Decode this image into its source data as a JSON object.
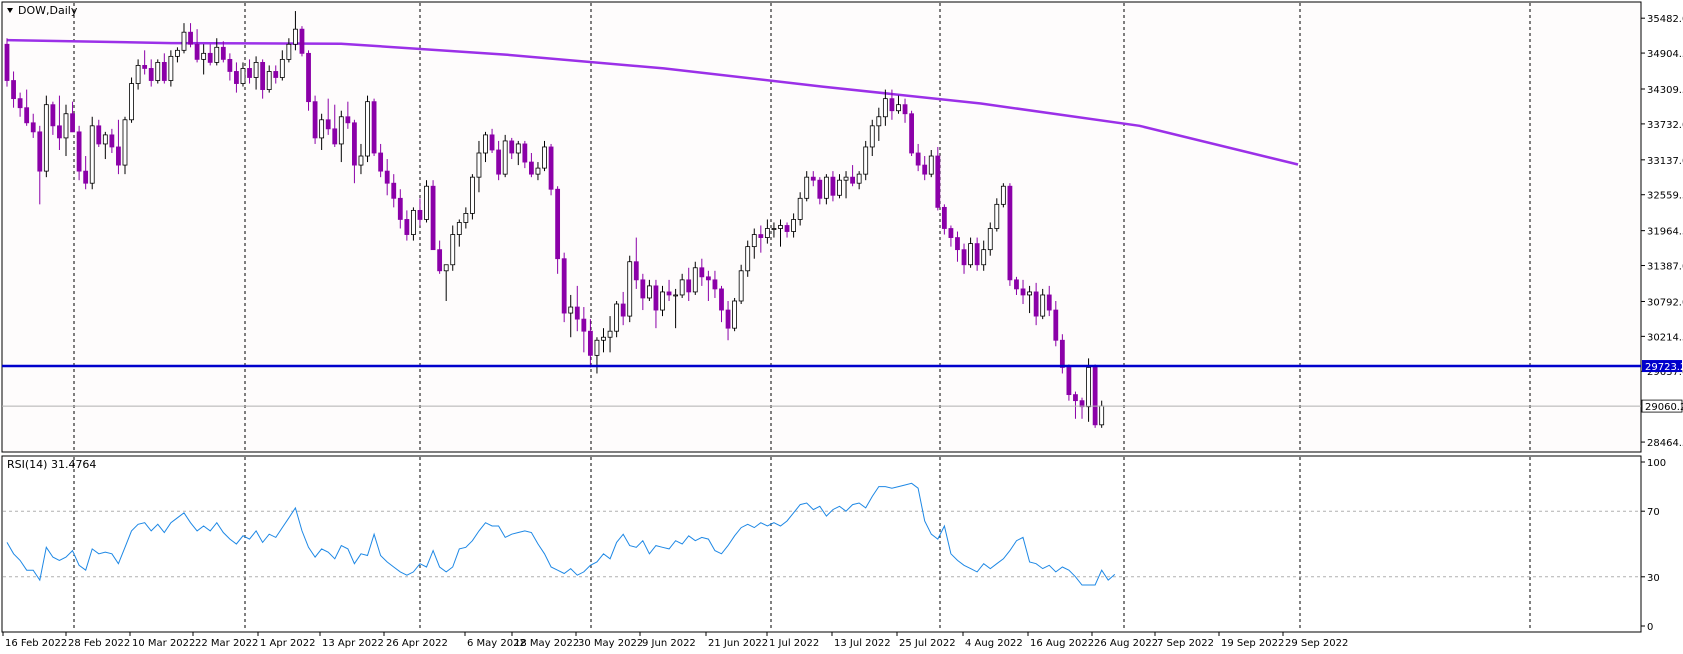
{
  "chart_window": {
    "symbol_timeframe": "DOW,Daily",
    "indicator_label": "RSI(14) 31.4764",
    "colors": {
      "background": "#fefcfc",
      "panel_background": "#ffffff",
      "bull_candle_fill": "#ffffff",
      "bull_candle_border": "#000000",
      "bear_candle_fill": "#8b00a8",
      "moving_average": "#9b30e8",
      "support_line": "#0000cc",
      "rsi_line": "#1e88e5",
      "grid_line": "#000000",
      "level_line": "#b0b0b0"
    }
  },
  "chart_data": [
    {
      "type": "candlestick",
      "panel": "price",
      "x_tick_labels": [
        "16 Feb 2022",
        "28 Feb 2022",
        "10 Mar 2022",
        "22 Mar 2022",
        "1 Apr 2022",
        "13 Apr 2022",
        "26 Apr 2022",
        "6 May 2022",
        "18 May 2022",
        "30 May 2022",
        "9 Jun 2022",
        "21 Jun 2022",
        "1 Jul 2022",
        "13 Jul 2022",
        "25 Jul 2022",
        "4 Aug 2022",
        "16 Aug 2022",
        "26 Aug 2022",
        "7 Sep 2022",
        "19 Sep 2022",
        "29 Sep 2022"
      ],
      "y_tick_labels": [
        "35482.0",
        "34904.5",
        "34309.5",
        "33732.0",
        "33137.0",
        "32559.5",
        "31964.5",
        "31387.0",
        "30792.0",
        "30214.5",
        "29637.0",
        "28464.5"
      ],
      "ylim": [
        28300,
        35750
      ],
      "horizontal_levels": [
        {
          "label": "29723.2",
          "value": 29723.2
        },
        {
          "label": "29060.2",
          "value": 29060.2
        }
      ],
      "moving_average_points": [
        {
          "date": "2022-02-14",
          "value": 35120
        },
        {
          "date": "2022-03-15",
          "value": 35070
        },
        {
          "date": "2022-04-14",
          "value": 35060
        },
        {
          "date": "2022-05-13",
          "value": 34880
        },
        {
          "date": "2022-06-10",
          "value": 34650
        },
        {
          "date": "2022-07-08",
          "value": 34350
        },
        {
          "date": "2022-08-05",
          "value": 34070
        },
        {
          "date": "2022-09-02",
          "value": 33700
        },
        {
          "date": "2022-09-30",
          "value": 33060
        }
      ],
      "candles_ohlc": [
        [
          35050,
          35150,
          34350,
          34450
        ],
        [
          34450,
          34600,
          34000,
          34150
        ],
        [
          34150,
          34250,
          33850,
          34000
        ],
        [
          34000,
          34300,
          33700,
          33750
        ],
        [
          33750,
          33900,
          33500,
          33600
        ],
        [
          33600,
          33700,
          32400,
          32950
        ],
        [
          32950,
          34200,
          32850,
          34050
        ],
        [
          34050,
          34100,
          33550,
          33700
        ],
        [
          33700,
          34200,
          33300,
          33500
        ],
        [
          33500,
          34050,
          33200,
          33900
        ],
        [
          33900,
          34100,
          33600,
          33600
        ],
        [
          33600,
          33700,
          32800,
          32950
        ],
        [
          32950,
          33200,
          32650,
          32750
        ],
        [
          32750,
          33850,
          32650,
          33700
        ],
        [
          33700,
          33800,
          33350,
          33400
        ],
        [
          33400,
          33600,
          33150,
          33550
        ],
        [
          33550,
          33650,
          33250,
          33350
        ],
        [
          33350,
          33800,
          32900,
          33050
        ],
        [
          33050,
          33850,
          32900,
          33800
        ],
        [
          33800,
          34500,
          33750,
          34400
        ],
        [
          34400,
          34800,
          34300,
          34700
        ],
        [
          34700,
          34950,
          34550,
          34650
        ],
        [
          34650,
          34800,
          34350,
          34450
        ],
        [
          34450,
          34800,
          34400,
          34750
        ],
        [
          34750,
          34900,
          34400,
          34450
        ],
        [
          34450,
          34950,
          34350,
          34850
        ],
        [
          34850,
          35000,
          34750,
          34950
        ],
        [
          34950,
          35400,
          34900,
          35250
        ],
        [
          35250,
          35400,
          35000,
          35050
        ],
        [
          35050,
          35300,
          34750,
          34800
        ],
        [
          34800,
          35050,
          34550,
          34900
        ],
        [
          34900,
          35050,
          34700,
          34750
        ],
        [
          34750,
          35150,
          34700,
          35000
        ],
        [
          35000,
          35100,
          34750,
          34800
        ],
        [
          34800,
          34900,
          34450,
          34600
        ],
        [
          34600,
          34750,
          34250,
          34400
        ],
        [
          34400,
          34750,
          34350,
          34650
        ],
        [
          34650,
          34800,
          34400,
          34500
        ],
        [
          34500,
          34850,
          34300,
          34750
        ],
        [
          34750,
          34800,
          34150,
          34300
        ],
        [
          34300,
          34700,
          34250,
          34600
        ],
        [
          34600,
          34700,
          34400,
          34500
        ],
        [
          34500,
          34950,
          34450,
          34800
        ],
        [
          34800,
          35150,
          34750,
          35050
        ],
        [
          35050,
          35600,
          34950,
          35300
        ],
        [
          35300,
          35350,
          34850,
          34900
        ],
        [
          34900,
          34950,
          33950,
          34100
        ],
        [
          34100,
          34200,
          33400,
          33500
        ],
        [
          33500,
          33900,
          33300,
          33800
        ],
        [
          33800,
          34150,
          33550,
          33650
        ],
        [
          33650,
          34050,
          33350,
          33400
        ],
        [
          33400,
          33950,
          33100,
          33850
        ],
        [
          33850,
          34100,
          33650,
          33750
        ],
        [
          33750,
          33800,
          32750,
          33050
        ],
        [
          33050,
          33400,
          32900,
          33200
        ],
        [
          33200,
          34200,
          33100,
          34100
        ],
        [
          34100,
          34150,
          33200,
          33250
        ],
        [
          33250,
          33400,
          32850,
          32950
        ],
        [
          32950,
          33150,
          32550,
          32750
        ],
        [
          32750,
          32900,
          32350,
          32500
        ],
        [
          32500,
          32650,
          32000,
          32150
        ],
        [
          32150,
          32300,
          31800,
          31900
        ],
        [
          31900,
          32350,
          31800,
          32300
        ],
        [
          32300,
          32500,
          32050,
          32150
        ],
        [
          32150,
          32800,
          32100,
          32700
        ],
        [
          32700,
          32800,
          31650,
          31650
        ],
        [
          31650,
          31800,
          31250,
          31300
        ],
        [
          31300,
          31400,
          30800,
          31400
        ],
        [
          31400,
          32050,
          31300,
          31900
        ],
        [
          31900,
          32150,
          31700,
          32100
        ],
        [
          32100,
          32350,
          32000,
          32250
        ],
        [
          32250,
          32900,
          32150,
          32850
        ],
        [
          32850,
          33450,
          32600,
          33250
        ],
        [
          33250,
          33600,
          33100,
          33550
        ],
        [
          33550,
          33650,
          33250,
          33300
        ],
        [
          33300,
          33450,
          32800,
          32900
        ],
        [
          32900,
          33550,
          32850,
          33450
        ],
        [
          33450,
          33500,
          33150,
          33250
        ],
        [
          33250,
          33450,
          33050,
          33400
        ],
        [
          33400,
          33450,
          33000,
          33100
        ],
        [
          33100,
          33250,
          32850,
          32900
        ],
        [
          32900,
          33100,
          32800,
          33000
        ],
        [
          33000,
          33450,
          32950,
          33350
        ],
        [
          33350,
          33400,
          32550,
          32650
        ],
        [
          32650,
          32700,
          31250,
          31500
        ],
        [
          31500,
          31600,
          30450,
          30600
        ],
        [
          30600,
          30900,
          30200,
          30700
        ],
        [
          30700,
          31050,
          30300,
          30500
        ],
        [
          30500,
          30700,
          29950,
          30300
        ],
        [
          30300,
          30500,
          29700,
          29900
        ],
        [
          29900,
          30200,
          29600,
          30150
        ],
        [
          30150,
          30350,
          29950,
          30200
        ],
        [
          30200,
          30550,
          29950,
          30300
        ],
        [
          30300,
          30800,
          30200,
          30750
        ],
        [
          30750,
          30950,
          30400,
          30550
        ],
        [
          30550,
          31550,
          30450,
          31450
        ],
        [
          31450,
          31850,
          31000,
          31150
        ],
        [
          31150,
          31250,
          30650,
          30850
        ],
        [
          30850,
          31150,
          30800,
          31050
        ],
        [
          31050,
          31150,
          30350,
          30650
        ],
        [
          30650,
          31050,
          30550,
          30950
        ],
        [
          30950,
          31150,
          30800,
          30900
        ],
        [
          30900,
          31000,
          30350,
          30900
        ],
        [
          30900,
          31250,
          30850,
          31150
        ],
        [
          31150,
          31350,
          30800,
          30950
        ],
        [
          30950,
          31450,
          30900,
          31350
        ],
        [
          31350,
          31500,
          31050,
          31200
        ],
        [
          31200,
          31300,
          30800,
          31150
        ],
        [
          31150,
          31300,
          30850,
          31000
        ],
        [
          31000,
          31050,
          30450,
          30650
        ],
        [
          30650,
          30800,
          30150,
          30350
        ],
        [
          30350,
          30850,
          30300,
          30800
        ],
        [
          30800,
          31400,
          30750,
          31300
        ],
        [
          31300,
          31800,
          31200,
          31700
        ],
        [
          31700,
          32000,
          31500,
          31900
        ],
        [
          31900,
          32050,
          31600,
          31850
        ],
        [
          31850,
          32150,
          31750,
          32000
        ],
        [
          32000,
          32100,
          31850,
          32000
        ],
        [
          32000,
          32150,
          31700,
          32050
        ],
        [
          32050,
          32100,
          31850,
          31950
        ],
        [
          31950,
          32250,
          31850,
          32150
        ],
        [
          32150,
          32600,
          32050,
          32500
        ],
        [
          32500,
          32950,
          32450,
          32850
        ],
        [
          32850,
          32950,
          32700,
          32800
        ],
        [
          32800,
          32850,
          32400,
          32500
        ],
        [
          32500,
          32900,
          32400,
          32850
        ],
        [
          32850,
          32950,
          32450,
          32550
        ],
        [
          32550,
          32900,
          32500,
          32800
        ],
        [
          32800,
          32950,
          32500,
          32850
        ],
        [
          32850,
          33050,
          32700,
          32750
        ],
        [
          32750,
          32950,
          32650,
          32900
        ],
        [
          32900,
          33450,
          32800,
          33350
        ],
        [
          33350,
          33800,
          33200,
          33700
        ],
        [
          33700,
          34000,
          33450,
          33850
        ],
        [
          33850,
          34300,
          33700,
          34150
        ],
        [
          34150,
          34300,
          33800,
          33950
        ],
        [
          33950,
          34200,
          33900,
          34050
        ],
        [
          34050,
          34150,
          33750,
          33900
        ],
        [
          33900,
          33950,
          33200,
          33250
        ],
        [
          33250,
          33400,
          32950,
          33050
        ],
        [
          33050,
          33200,
          32800,
          32900
        ],
        [
          32900,
          33300,
          32850,
          33200
        ],
        [
          33200,
          33350,
          32300,
          32350
        ],
        [
          32350,
          32400,
          31900,
          32000
        ],
        [
          32000,
          32050,
          31700,
          31850
        ],
        [
          31850,
          31950,
          31450,
          31650
        ],
        [
          31650,
          31750,
          31250,
          31400
        ],
        [
          31400,
          31850,
          31350,
          31750
        ],
        [
          31750,
          31850,
          31300,
          31400
        ],
        [
          31400,
          31800,
          31300,
          31650
        ],
        [
          31650,
          32100,
          31550,
          32000
        ],
        [
          32000,
          32500,
          31950,
          32400
        ],
        [
          32400,
          32750,
          32350,
          32700
        ],
        [
          32700,
          32750,
          31050,
          31150
        ],
        [
          31150,
          31200,
          30900,
          31000
        ],
        [
          31000,
          31150,
          30750,
          30900
        ],
        [
          30900,
          31050,
          30600,
          30950
        ],
        [
          30950,
          31100,
          30400,
          30550
        ],
        [
          30550,
          31000,
          30500,
          30900
        ],
        [
          30900,
          31050,
          30550,
          30650
        ],
        [
          30650,
          30800,
          30050,
          30150
        ],
        [
          30150,
          30250,
          29600,
          29700
        ],
        [
          29700,
          29750,
          29150,
          29250
        ],
        [
          29250,
          29300,
          28850,
          29150
        ],
        [
          29150,
          29200,
          28850,
          29050
        ],
        [
          29050,
          29850,
          28800,
          29700
        ],
        [
          29700,
          29750,
          28700,
          28750
        ],
        [
          28750,
          29150,
          28700,
          29060
        ]
      ]
    },
    {
      "type": "line",
      "panel": "oscillator",
      "series": [
        {
          "name": "RSI(14) 31.4764"
        }
      ],
      "y_tick_labels": [
        "100",
        "70",
        "30",
        "0"
      ],
      "ylim": [
        0,
        100
      ],
      "levels": [
        70,
        30
      ],
      "rsi_values": [
        51,
        44,
        40,
        34,
        34,
        28,
        48,
        42,
        40,
        42,
        46,
        37,
        34,
        47,
        44,
        45,
        44,
        38,
        48,
        58,
        62,
        63,
        58,
        62,
        57,
        63,
        66,
        69,
        63,
        58,
        61,
        58,
        63,
        57,
        53,
        50,
        55,
        53,
        58,
        51,
        56,
        54,
        60,
        66,
        72,
        58,
        48,
        42,
        47,
        45,
        41,
        49,
        47,
        38,
        44,
        43,
        56,
        43,
        39,
        36,
        33,
        31,
        33,
        38,
        36,
        46,
        36,
        33,
        36,
        47,
        48,
        52,
        58,
        63,
        61,
        61,
        54,
        56,
        57,
        58,
        57,
        50,
        44,
        36,
        34,
        32,
        35,
        31,
        33,
        37,
        39,
        44,
        41,
        51,
        56,
        49,
        48,
        52,
        44,
        49,
        48,
        47,
        52,
        50,
        55,
        52,
        54,
        53,
        46,
        44,
        49,
        55,
        60,
        62,
        60,
        63,
        61,
        63,
        61,
        64,
        69,
        74,
        75,
        71,
        73,
        67,
        71,
        73,
        70,
        74,
        75,
        72,
        79,
        85,
        85,
        84,
        85,
        86,
        87,
        84,
        64,
        56,
        53,
        61,
        44,
        40,
        37,
        35,
        33,
        38,
        35,
        38,
        41,
        46,
        52,
        54,
        39,
        38,
        35,
        37,
        33,
        36,
        34,
        30,
        25,
        25,
        25,
        34,
        28,
        31.4764
      ]
    }
  ]
}
